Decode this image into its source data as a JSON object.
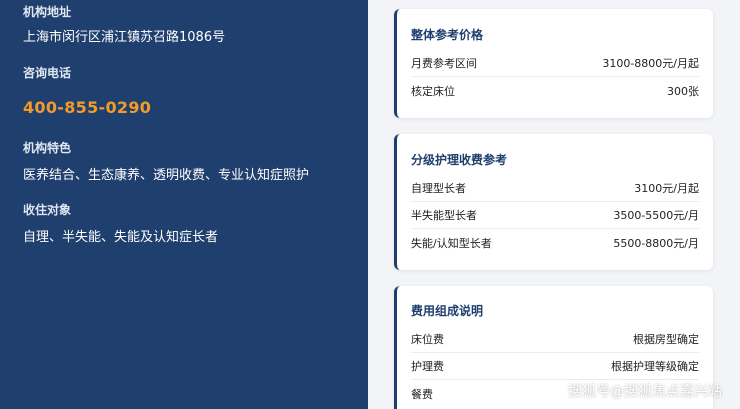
{
  "institution": {
    "address_label": "机构地址",
    "address": "上海市闵行区浦江镇苏召路1086号",
    "phone_label": "咨询电话",
    "phone": "400-855-0290",
    "features_label": "机构特色",
    "features": "医养结合、生态康养、透明收费、专业认知症照护",
    "target_label": "收住对象",
    "target": "自理、半失能、失能及认知症长者"
  },
  "cards": [
    {
      "title": "整体参考价格",
      "rows": [
        {
          "label": "月费参考区间",
          "value": "3100-8800元/月起"
        },
        {
          "label": "核定床位",
          "value": "300张"
        }
      ]
    },
    {
      "title": "分级护理收费参考",
      "rows": [
        {
          "label": "自理型长者",
          "value": "3100元/月起"
        },
        {
          "label": "半失能型长者",
          "value": "3500-5500元/月"
        },
        {
          "label": "失能/认知型长者",
          "value": "5500-8800元/月"
        }
      ]
    },
    {
      "title": "费用组成说明",
      "rows": [
        {
          "label": "床位费",
          "value": "根据房型确定"
        },
        {
          "label": "护理费",
          "value": "根据护理等级确定"
        },
        {
          "label": "餐费",
          "value": ""
        }
      ]
    }
  ],
  "watermark": "搜狐号@搜狐焦点嘉兴站",
  "colors": {
    "panel": "#1f3f6e",
    "accent": "#f39b2a",
    "background": "#f2f4f7"
  }
}
